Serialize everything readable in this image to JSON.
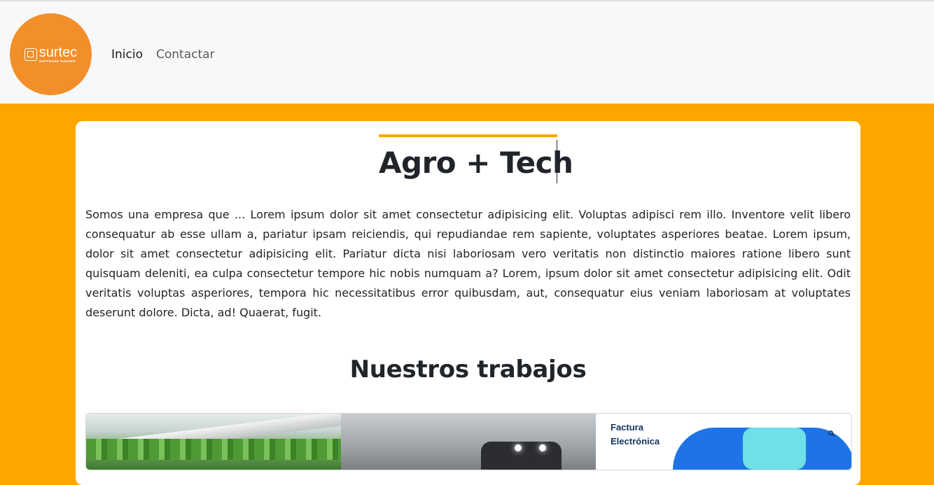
{
  "header": {
    "logo": {
      "name": "surtec",
      "tagline": "SOFTWARE MAKERS",
      "color": "#f28f2a"
    },
    "nav": [
      {
        "label": "Inicio",
        "active": true
      },
      {
        "label": "Contactar",
        "active": false
      }
    ]
  },
  "theme": {
    "background": "#ffa500",
    "header_background": "#f7f8f9"
  },
  "main": {
    "title": "Agro + Tech",
    "description": "Somos una empresa que ... Lorem ipsum dolor sit amet consectetur adipisicing elit. Voluptas adipisci rem illo. Inventore velit libero consequatur ab esse ullam a, pariatur ipsam reiciendis, qui repudiandae rem sapiente, voluptates asperiores beatae. Lorem ipsum, dolor sit amet consectetur adipisicing elit. Pariatur dicta nisi laboriosam vero veritatis non distinctio maiores ratione libero sunt quisquam deleniti, ea culpa consectetur tempore hic nobis numquam a? Lorem, ipsum dolor sit amet consectetur adipisicing elit. Odit veritatis voluptas asperiores, tempora hic necessitatibus error quibusdam, aut, consequatur eius veniam laboriosam at voluptates deserunt dolore. Dicta, ad! Quaerat, fugit.",
    "works_title": "Nuestros trabajos",
    "works": [
      {
        "image": "hydroponic-greenhouse"
      },
      {
        "image": "agricultural-robot"
      },
      {
        "image": "factura-electronica",
        "caption_line1": "Factura",
        "caption_line2": "Electrónica",
        "icon": "search-icon"
      }
    ]
  }
}
